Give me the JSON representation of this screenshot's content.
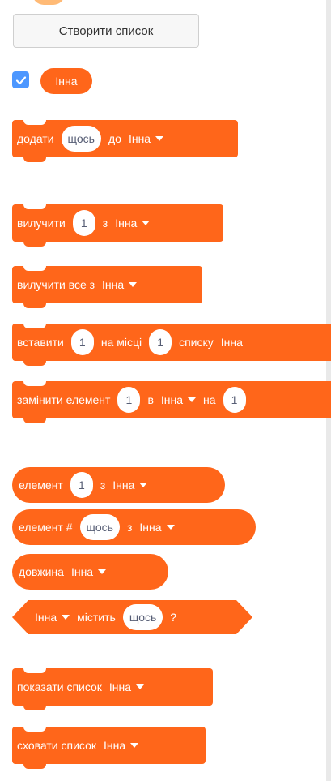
{
  "make_list_button": "Створити список",
  "list_name": "Інна",
  "blocks": {
    "add": {
      "verb": "додати",
      "input": "щось",
      "to": "до",
      "list": "Інна"
    },
    "delete": {
      "verb": "вилучити",
      "input": "1",
      "from": "з",
      "list": "Інна"
    },
    "delete_all": {
      "verb": "вилучити все з",
      "list": "Інна"
    },
    "insert": {
      "verb": "вставити",
      "input": "1",
      "at": "на місці",
      "index": "1",
      "of_list": "списку",
      "list": "Інна"
    },
    "replace": {
      "verb": "замінити елемент",
      "input": "1",
      "in": "в",
      "list": "Інна",
      "with": "на",
      "value": "1"
    },
    "item": {
      "verb": "елемент",
      "input": "1",
      "from": "з",
      "list": "Інна"
    },
    "item_index": {
      "verb": "елемент #",
      "input": "щось",
      "from": "з",
      "list": "Інна"
    },
    "length": {
      "verb": "довжина",
      "list": "Інна"
    },
    "contains": {
      "list": "Інна",
      "verb": "містить",
      "input": "щось",
      "q": "?"
    },
    "show": {
      "verb": "показати список",
      "list": "Інна"
    },
    "hide": {
      "verb": "сховати список",
      "list": "Інна"
    }
  },
  "colors": {
    "list_block": "#ff661a",
    "checkbox": "#4c97ff",
    "input_text": "#575e75"
  }
}
